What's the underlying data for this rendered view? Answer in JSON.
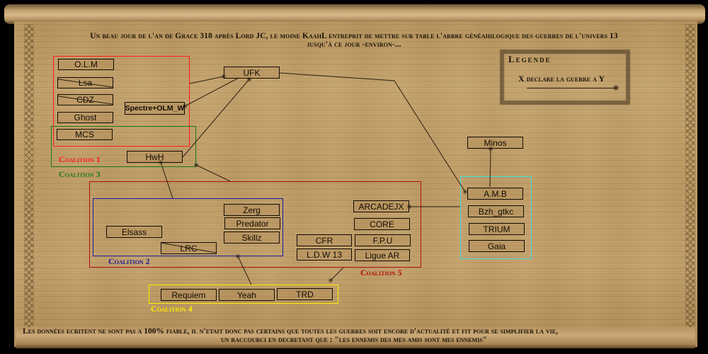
{
  "header": {
    "line1": "Un beau jour de l'an de Grace 318 après Lord JC, le moine KaahL entreprit de mettre sur table l'arbre généahilogique des guerres de l'univers 13",
    "line2": "jusqu'à ce jour -environ-..."
  },
  "legend": {
    "title": "Legende",
    "description": "X declare la guerre a Y"
  },
  "coalitions": {
    "c1": {
      "label": "Coalition 1",
      "color": "#ff1a1a"
    },
    "c2": {
      "label": "Coalition 2",
      "color": "#1a1aa0"
    },
    "c3": {
      "label": "Coalition 3",
      "color": "#1a7a1a"
    },
    "c4": {
      "label": "Coalition 4",
      "color": "#ffee00"
    },
    "c5": {
      "label": "Coalition 5",
      "color": "#b01010"
    },
    "c6": {
      "label": "",
      "color": "#40e0e0"
    }
  },
  "nodes": {
    "olm": {
      "label": "O.L.M",
      "struck": false
    },
    "lsa": {
      "label": "Lsa",
      "struck": true
    },
    "cdz": {
      "label": "CDZ",
      "struck": true
    },
    "ghost": {
      "label": "Ghost",
      "struck": false
    },
    "mcs": {
      "label": "MCS",
      "struck": false
    },
    "spectre": {
      "label": "Spectre+OLM_W",
      "struck": false
    },
    "ufk": {
      "label": "UFK",
      "struck": false
    },
    "hwh": {
      "label": "HwH",
      "struck": false
    },
    "zerg": {
      "label": "Zerg",
      "struck": false
    },
    "predator": {
      "label": "Predator",
      "struck": false
    },
    "skillz": {
      "label": "Skillz",
      "struck": false
    },
    "elsass": {
      "label": "Elsass",
      "struck": false
    },
    "lrc": {
      "label": "LRC",
      "struck": true
    },
    "arcadejx": {
      "label": "ARCADEJX",
      "struck": false
    },
    "core": {
      "label": "CORE",
      "struck": false
    },
    "cfr": {
      "label": "CFR",
      "struck": false
    },
    "fpu": {
      "label": "F.P.U",
      "struck": false
    },
    "ldw13": {
      "label": "L.D.W 13",
      "struck": false
    },
    "liguear": {
      "label": "Ligue AR",
      "struck": false
    },
    "minos": {
      "label": "Minos",
      "struck": false
    },
    "amb": {
      "label": "A.M.B",
      "struck": false
    },
    "bzh": {
      "label": "Bzh_gtkc",
      "struck": false
    },
    "trium": {
      "label": "TRIUM",
      "struck": false
    },
    "gaia": {
      "label": "Gaia",
      "struck": false
    },
    "requiem": {
      "label": "Requiem",
      "struck": false
    },
    "yeah": {
      "label": "Yeah",
      "struck": false
    },
    "trd": {
      "label": "TRD",
      "struck": false
    }
  },
  "wars": [
    {
      "from": "Coalition 1",
      "to": "UFK"
    },
    {
      "from": "UFK",
      "to": "Spectre+OLM_W"
    },
    {
      "from": "HwH",
      "to": "UFK"
    },
    {
      "from": "UFK",
      "to": "A.M.B"
    },
    {
      "from": "Coalition 5",
      "to": "Coalition 3"
    },
    {
      "from": "Coalition 2",
      "to": "HwH"
    },
    {
      "from": "A.M.B",
      "to": "ARCADEJX"
    },
    {
      "from": "A.M.B",
      "to": "Minos"
    },
    {
      "from": "Coalition 4",
      "to": "Coalition 2"
    },
    {
      "from": "Coalition 5",
      "to": "Coalition 4"
    }
  ],
  "footer": {
    "line1": "Les données ecritent ne sont pas a 100% fiable, il n'etait donc pas certains que toutes les guerres soit encore d'actualité et fit pour se simplifier la vie,",
    "line2": "un raccourci en decretant que : \"les ennemis des mes amis sont mes ennemis\""
  }
}
